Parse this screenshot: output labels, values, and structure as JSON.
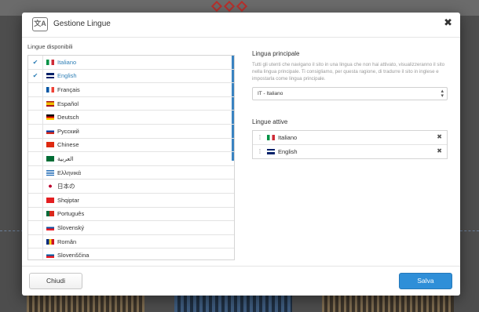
{
  "modal": {
    "title": "Gestione Lingue",
    "icon": "translate-icon",
    "close_symbol": "✖"
  },
  "available": {
    "label": "Lingue disponibili",
    "items": [
      {
        "label": "Italiano",
        "flag": "it",
        "checked": true
      },
      {
        "label": "English",
        "flag": "gb",
        "checked": true
      },
      {
        "label": "Français",
        "flag": "fr",
        "checked": false
      },
      {
        "label": "Español",
        "flag": "es",
        "checked": false
      },
      {
        "label": "Deutsch",
        "flag": "de",
        "checked": false
      },
      {
        "label": "Русский",
        "flag": "ru",
        "checked": false
      },
      {
        "label": "Chinese",
        "flag": "cn",
        "checked": false
      },
      {
        "label": "العربية",
        "flag": "sa",
        "checked": false
      },
      {
        "label": "Ελληνικά",
        "flag": "gr",
        "checked": false
      },
      {
        "label": "日本の",
        "flag": "jp",
        "checked": false
      },
      {
        "label": "Shqiptar",
        "flag": "al",
        "checked": false
      },
      {
        "label": "Português",
        "flag": "pt",
        "checked": false
      },
      {
        "label": "Slovenský",
        "flag": "sk",
        "checked": false
      },
      {
        "label": "Român",
        "flag": "ro",
        "checked": false
      },
      {
        "label": "Slovenščina",
        "flag": "si",
        "checked": false
      }
    ]
  },
  "main_language": {
    "label": "Lingua principale",
    "help": "Tutti gli utenti che navigano il sito in una lingua che non hai attivato, visualizzeranno il sito nella lingua principale. Ti consigliamo, per questa ragione, di tradurre il sito in inglese e impostarla come lingua principale.",
    "selected": "IT - Italiano"
  },
  "active_languages": {
    "label": "Lingue attive",
    "items": [
      {
        "label": "Italiano",
        "flag": "it"
      },
      {
        "label": "English",
        "flag": "gb"
      }
    ]
  },
  "footer": {
    "close_label": "Chiudi",
    "save_label": "Salva"
  }
}
